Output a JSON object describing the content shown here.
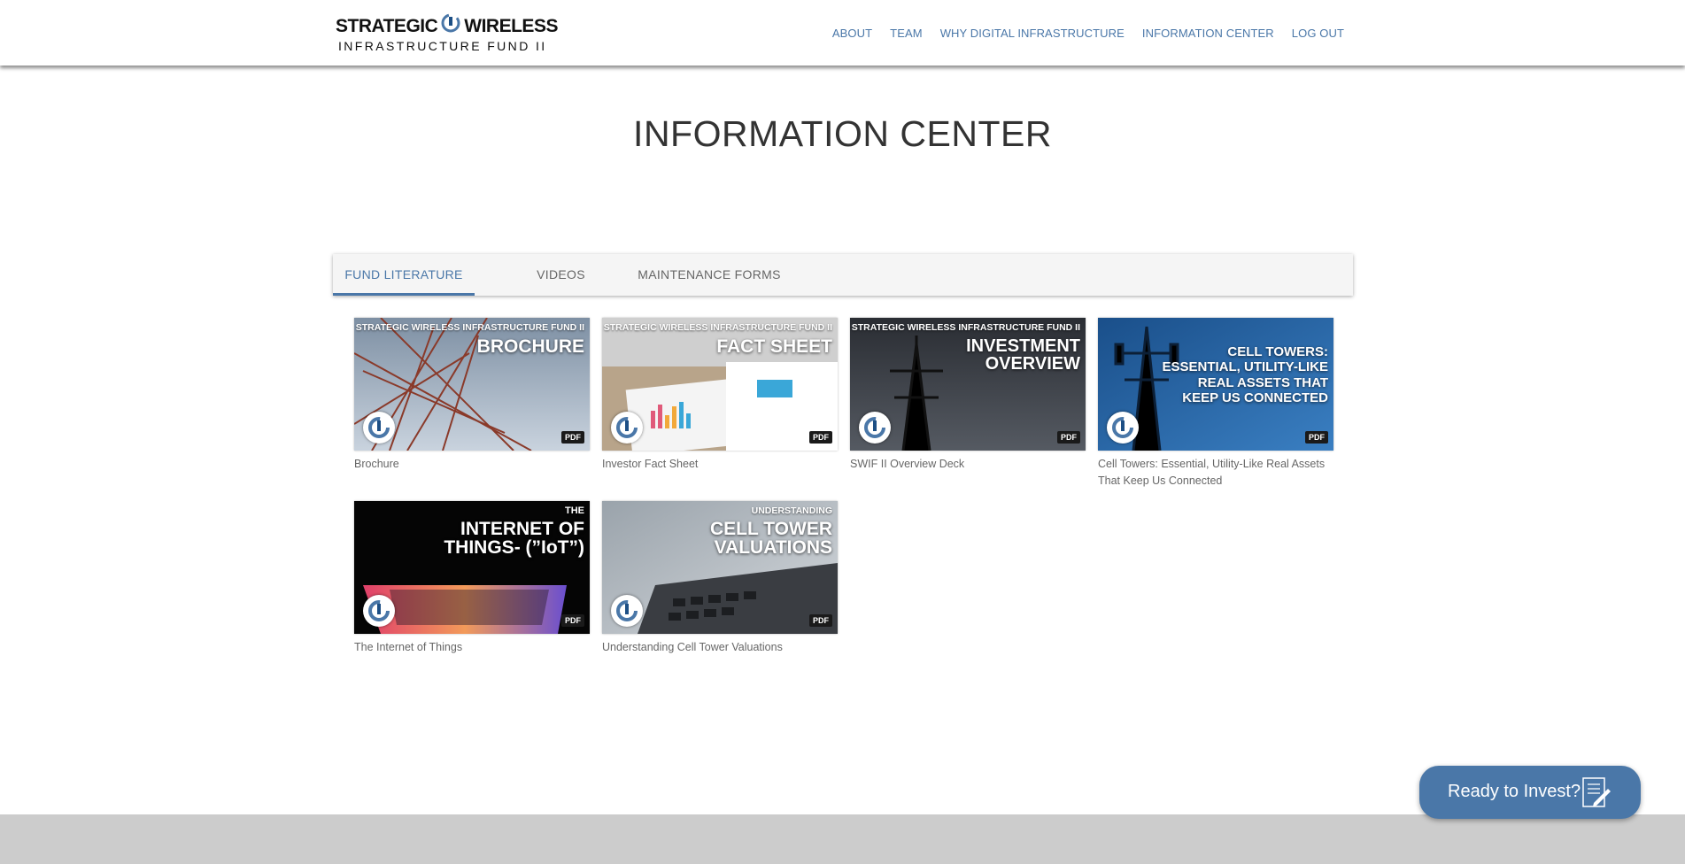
{
  "logo": {
    "line1_left": "STRATEGIC",
    "line1_right": "WIRELESS",
    "line2": "INFRASTRUCTURE FUND II"
  },
  "nav": {
    "items": [
      {
        "label": "ABOUT"
      },
      {
        "label": "TEAM"
      },
      {
        "label": "WHY DIGITAL INFRASTRUCTURE"
      },
      {
        "label": "INFORMATION CENTER"
      },
      {
        "label": "LOG OUT"
      }
    ]
  },
  "page": {
    "title": "INFORMATION CENTER"
  },
  "tabs": [
    {
      "label": "FUND LITERATURE",
      "active": true
    },
    {
      "label": "VIDEOS",
      "active": false
    },
    {
      "label": "MAINTENANCE FORMS",
      "active": false
    }
  ],
  "cards": [
    {
      "top": "STRATEGIC WIRELESS INFRASTRUCTURE FUND II",
      "title_lines": [
        "BROCHURE"
      ],
      "badge": "PDF",
      "caption": "Brochure"
    },
    {
      "top": "STRATEGIC WIRELESS INFRASTRUCTURE FUND II",
      "title_lines": [
        "FACT SHEET"
      ],
      "badge": "PDF",
      "caption": "Investor Fact Sheet"
    },
    {
      "top": "STRATEGIC WIRELESS INFRASTRUCTURE FUND II",
      "title_lines": [
        "INVESTMENT",
        "OVERVIEW"
      ],
      "badge": "PDF",
      "caption": "SWIF II Overview Deck"
    },
    {
      "top": "",
      "title_lines": [
        "CELL TOWERS:",
        "ESSENTIAL, UTILITY-LIKE",
        "REAL ASSETS THAT",
        "KEEP US CONNECTED"
      ],
      "badge": "PDF",
      "caption": "Cell Towers: Essential, Utility-Like Real Assets That Keep Us Connected"
    },
    {
      "top": "THE",
      "title_lines": [
        "INTERNET OF",
        "THINGS- (”IoT”)"
      ],
      "badge": "PDF",
      "caption": "The Internet of Things"
    },
    {
      "top": "UNDERSTANDING",
      "title_lines": [
        "CELL TOWER",
        "VALUATIONS"
      ],
      "badge": "PDF",
      "caption": "Understanding Cell Tower Valuations"
    }
  ],
  "cta": {
    "label": "Ready to Invest?"
  },
  "colors": {
    "accent": "#4a77a8",
    "footer": "#cccccc",
    "text_muted": "#666666"
  }
}
